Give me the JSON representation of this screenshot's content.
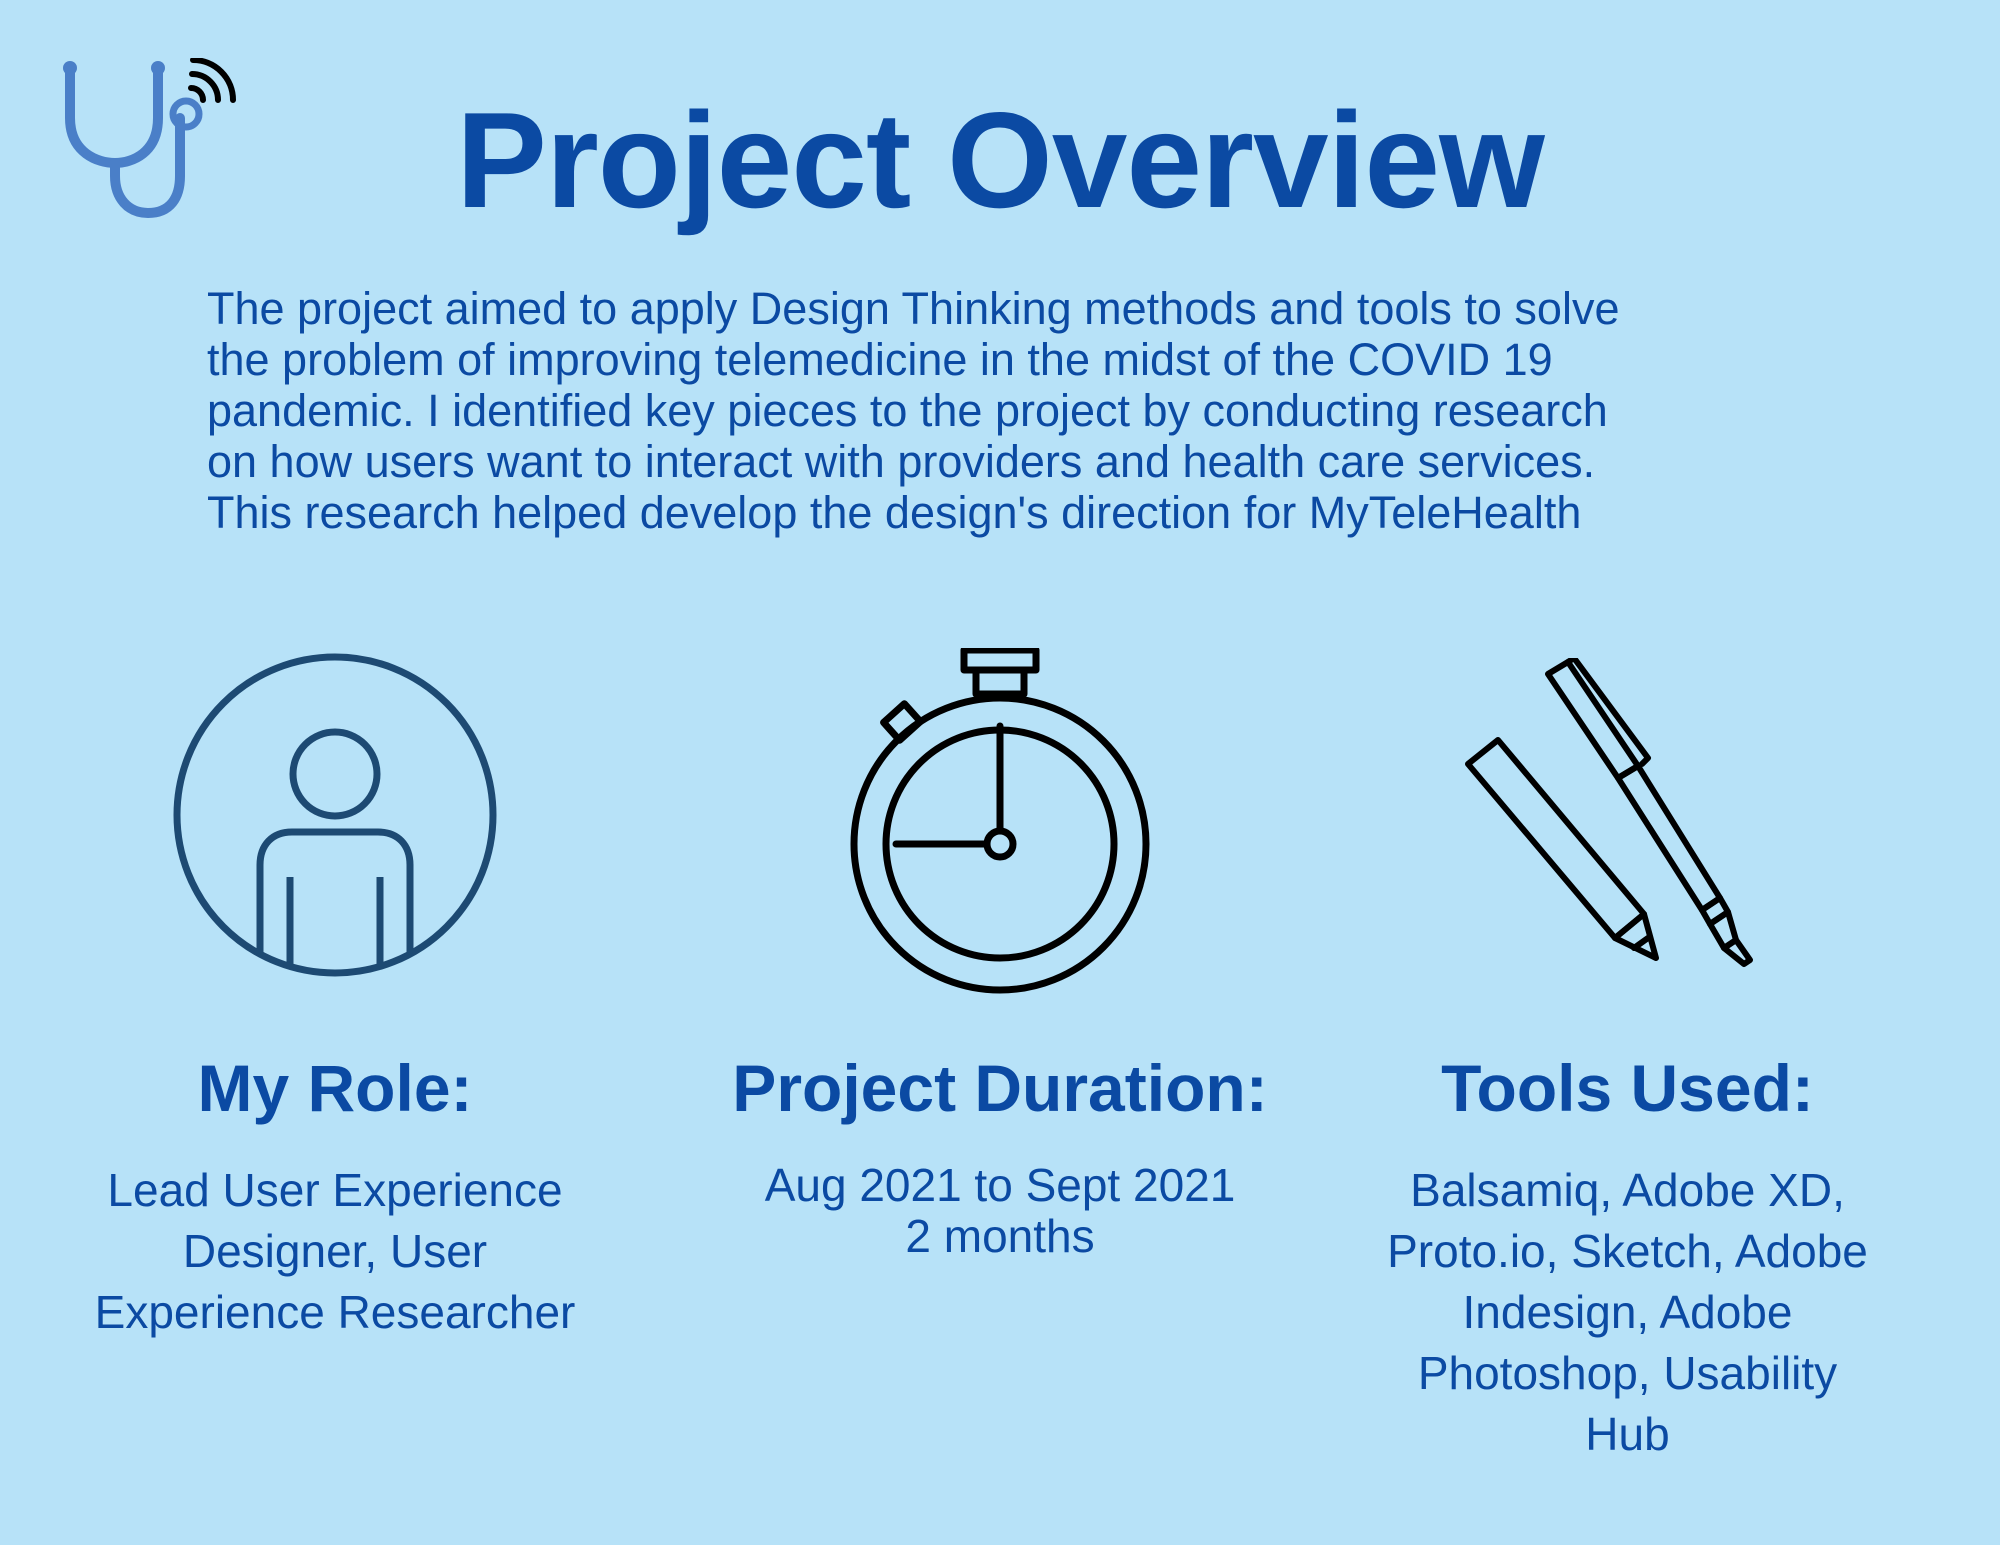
{
  "page": {
    "title": "Project Overview",
    "intro_lines": [
      "The project aimed to apply Design Thinking methods and tools to solve",
      "the problem of improving telemedicine in the midst of the COVID 19",
      "pandemic. I identified key pieces to the project by conducting research",
      "on how users want to interact with providers and health care services.",
      "This research helped develop the design's direction for MyTeleHealth"
    ],
    "logo_icon": "stethoscope-signal-icon"
  },
  "columns": [
    {
      "icon": "person-icon",
      "heading": "My Role:",
      "lines": [
        "Lead User Experience",
        "Designer, User",
        "Experience Researcher"
      ]
    },
    {
      "icon": "stopwatch-icon",
      "heading": "Project Duration:",
      "lines": [
        "Aug 2021 to Sept 2021",
        "2 months"
      ]
    },
    {
      "icon": "pen-and-marker-icon",
      "heading": "Tools Used:",
      "lines": [
        "Balsamiq, Adobe XD,",
        "Proto.io, Sketch, Adobe",
        "Indesign, Adobe",
        "Photoshop, Usability",
        "Hub"
      ]
    }
  ],
  "colors": {
    "background": "#b7e2f8",
    "text": "#0b4aa3",
    "logo": "#4a7fc8",
    "person_icon": "#1d4a73",
    "line_icons": "#000000"
  }
}
